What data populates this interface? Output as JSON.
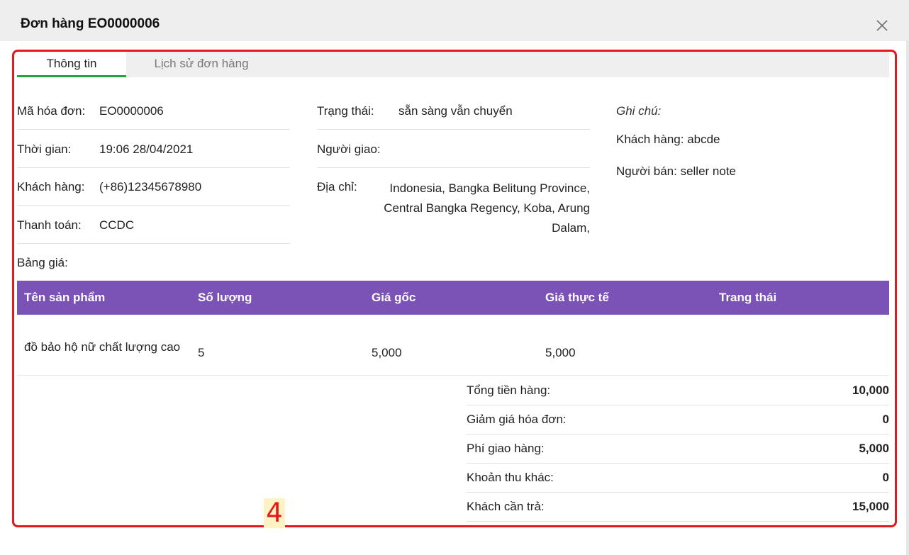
{
  "modal": {
    "title": "Đơn hàng EO0000006"
  },
  "tabs": [
    {
      "label": "Thông tin",
      "active": true
    },
    {
      "label": "Lịch sử đơn hàng",
      "active": false
    }
  ],
  "info_left": [
    {
      "label": "Mã hóa đơn:",
      "value": "EO0000006"
    },
    {
      "label": "Thời gian:",
      "value": "19:06 28/04/2021"
    },
    {
      "label": "Khách hàng:",
      "value": "(+86)12345678980"
    },
    {
      "label": "Thanh toán:",
      "value": "CCDC"
    },
    {
      "label": "Bảng giá:",
      "value": ""
    }
  ],
  "info_middle": {
    "status_label": "Trạng thái:",
    "status_value": "sẵn sàng vẫn chuyển",
    "shipper_label": "Người giao:",
    "shipper_value": "",
    "address_label": "Địa chỉ:",
    "address_lines": [
      "Indonesia, Bangka Belitung Province,",
      "Central Bangka Regency, Koba, Arung",
      "Dalam,"
    ]
  },
  "notes": {
    "title": "Ghi chú:",
    "customer_note": "Khách hàng: abcde",
    "seller_note": "Người bán: seller note"
  },
  "products_table": {
    "headers": [
      "Tên sản phẩm",
      "Số lượng",
      "Giá gốc",
      "Giá thực tế",
      "Trang thái"
    ],
    "rows": [
      {
        "name": "đồ bảo hộ nữ chất lượng cao",
        "quantity": "5",
        "original_price": "5,000",
        "actual_price": "5,000",
        "status": ""
      }
    ]
  },
  "summary": [
    {
      "label": "Tổng tiền hàng:",
      "value": "10,000"
    },
    {
      "label": "Giảm giá hóa đơn:",
      "value": "0"
    },
    {
      "label": "Phí giao hàng:",
      "value": "5,000"
    },
    {
      "label": "Khoản thu khác:",
      "value": "0"
    },
    {
      "label": "Khách cần trả:",
      "value": "15,000"
    }
  ],
  "annotation": {
    "step": "4",
    "highlight_color": "#e8151b"
  },
  "colors": {
    "tab_active_underline": "#25a244",
    "table_header_bg": "#7b52b5"
  }
}
